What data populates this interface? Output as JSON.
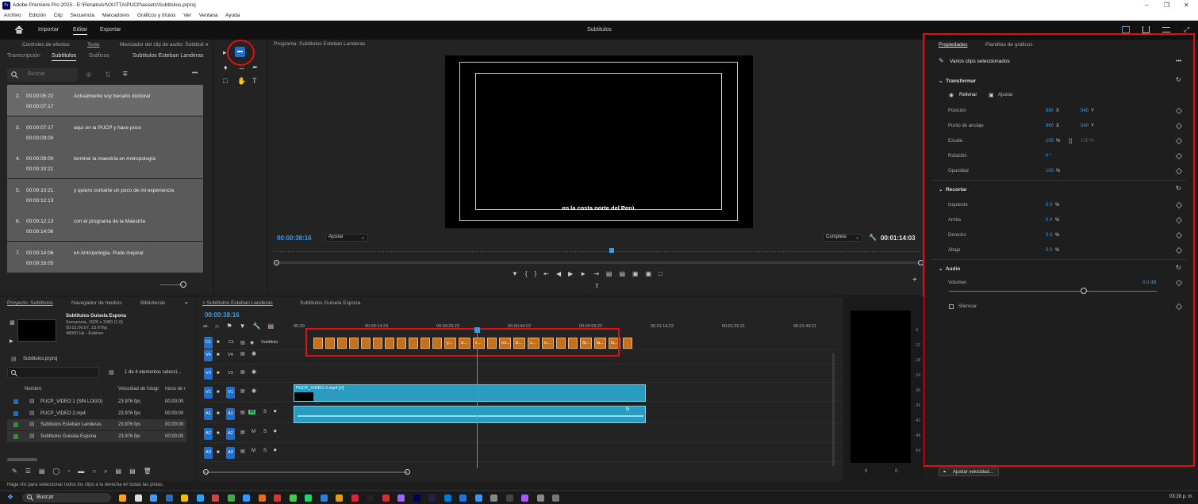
{
  "window": {
    "title": "Adobe Premiere Pro 2025 - E:\\RenatoArt\\OUTTA\\PUCP\\assets\\Subtitulos.prproj",
    "logo_text": "Pr"
  },
  "menu": [
    "Archivo",
    "Edición",
    "Clip",
    "Secuencia",
    "Marcadores",
    "Gráficos y títulos",
    "Ver",
    "Ventana",
    "Ayuda"
  ],
  "workspace": {
    "tabs": [
      "Importar",
      "Editar",
      "Exportar"
    ],
    "active": "Editar",
    "title": "Subtitulos"
  },
  "left_panel": {
    "tabs_top": [
      "Controles de efectos",
      "Texto",
      "Mezclador del clip de audio: Subtitulo"
    ],
    "tabs_sub": [
      "Transcripción",
      "Subtítulos",
      "Gráficos"
    ],
    "track_name": "Subtitulos Esteban Landeras",
    "search_placeholder": "Buscar",
    "more": "•••",
    "rows": [
      {
        "n": "2.",
        "tin": "00:00:05:22",
        "tout": "00:00:07:17",
        "text": "Actualmente soy becario doctoral"
      },
      {
        "n": "3.",
        "tin": "00:00:07:17",
        "tout": "00:00:09:00",
        "text": "aquí en la PUCP y hace poco"
      },
      {
        "n": "4.",
        "tin": "00:00:09:00",
        "tout": "00:00:10:21",
        "text": "terminé la maestría en Antropología"
      },
      {
        "n": "5.",
        "tin": "00:00:10:21",
        "tout": "00:00:12:13",
        "text": "y quiero contarte un poco de mi experiencia"
      },
      {
        "n": "6.",
        "tin": "00:00:12:13",
        "tout": "00:00:14:06",
        "text": "con el programa de la Maestría"
      },
      {
        "n": "7.",
        "tin": "00:00:14:06",
        "tout": "00:00:16:05",
        "text": "en Antropología. Pude mejorar"
      }
    ]
  },
  "program": {
    "header": "Programa: Subtitulos Esteban Landeras",
    "caption": "en la costa norte del Perú.",
    "timecode": "00:00:38:16",
    "fit": "Ajustar",
    "quality": "Completa",
    "duration": "00:01:14:03"
  },
  "project": {
    "tabs": [
      "Proyecto: Subtitulos",
      "Navegador de medios",
      "Bibliotecas"
    ],
    "more": "»",
    "seq_name": "Subtitulos Guisela Esponа",
    "seq_info1": "Secuencia, 1920 x 1080 (1.0)",
    "seq_info2": "00:01:06:07, 23.976p",
    "seq_info3": "48000 Hz - Estéreo",
    "file": "Subtitulos.prproj",
    "count": "1 de 4 elementos selecci...",
    "cols": [
      "Nombre",
      "Velocidad de fotogr",
      "Inicio de r"
    ],
    "items": [
      {
        "name": "PUCP_VIDEO 1 (SIN LOGO)",
        "fps": "23.976 fps",
        "start": "00:00:00",
        "color": "#2b6cb0",
        "sel": false
      },
      {
        "name": "PUCP_VIDEO 2.mp4",
        "fps": "23.976 fps",
        "start": "00:00:00",
        "color": "#2b6cb0",
        "sel": false
      },
      {
        "name": "Subtitulos Esteban Landeras",
        "fps": "23.976 fps",
        "start": "00:00:00",
        "color": "#3a8a3a",
        "sel": true
      },
      {
        "name": "Subtitulos Guisela Esponа",
        "fps": "23.976 fps",
        "start": "00:00:00",
        "color": "#3a8a3a",
        "sel": true
      }
    ]
  },
  "timeline": {
    "tabs": [
      "Subtitulos Esteban Landeras",
      "Subtitulos Guisela Esponа"
    ],
    "timecode": "00:00:38:16",
    "ruler": [
      "00:00",
      "00:00:14:23",
      "00:00:29:23",
      "00:00:44:22",
      "00:00:59:22",
      "00:01:14:22",
      "00:01:29:21",
      "00:01:44:21"
    ],
    "caption_track": "Subtitulo",
    "video_clip": "PUCP_VIDEO 2.mp4 [V]",
    "tracks": [
      "C1",
      "V4",
      "V3",
      "V1",
      "A1",
      "A2",
      "A3"
    ],
    "caption_labels": [
      "",
      "",
      "",
      "",
      "",
      "",
      "",
      "",
      "",
      "",
      "",
      "y...",
      "d...",
      "e...",
      "",
      "mi...",
      "E...",
      "c...",
      "e...",
      "",
      "",
      "Si...",
      "la...",
      "la...",
      ""
    ]
  },
  "properties": {
    "tabs": [
      "Propiedades",
      "Plantillas de gráficos"
    ],
    "selection": "Varios clips seleccionados",
    "more": "•••",
    "transform": {
      "title": "Transformar",
      "fill": "Rellenar",
      "fit": "Ajustar",
      "position": {
        "label": "Posición",
        "x": "960",
        "y": "540"
      },
      "anchor": {
        "label": "Punto de anclaje",
        "x": "960",
        "y": "540"
      },
      "scale": {
        "label": "Escala",
        "v": "100",
        "v2": "100 %"
      },
      "rotation": {
        "label": "Rotación",
        "v": "0 °"
      },
      "opacity": {
        "label": "Opacidad",
        "v": "100"
      }
    },
    "crop": {
      "title": "Recortar",
      "rows": [
        {
          "label": "Izquierdo",
          "v": "0.0"
        },
        {
          "label": "Arriba",
          "v": "0.0"
        },
        {
          "label": "Derecho",
          "v": "0.0"
        },
        {
          "label": "Abajo",
          "v": "0.0"
        }
      ]
    },
    "audio": {
      "title": "Audio",
      "volume_label": "Volumen",
      "volume": "0.0 dB",
      "mute": "Silenciar"
    },
    "speed_button": "Ajustar velocidad..."
  },
  "status_bar": "Haga clic para seleccionar todos los clips a la derecha en todas las pistas.",
  "taskbar": {
    "search": "Buscar",
    "clock": "03:28 p. m."
  },
  "meter_scale": [
    "-6",
    "-12",
    "-18",
    "-24",
    "-30",
    "-36",
    "-42",
    "-48",
    "-54"
  ],
  "colors": {
    "accent": "#1f6fd1",
    "highlight": "#e01010",
    "caption_clip": "#c5701a",
    "video_clip": "#2aa0c0"
  }
}
